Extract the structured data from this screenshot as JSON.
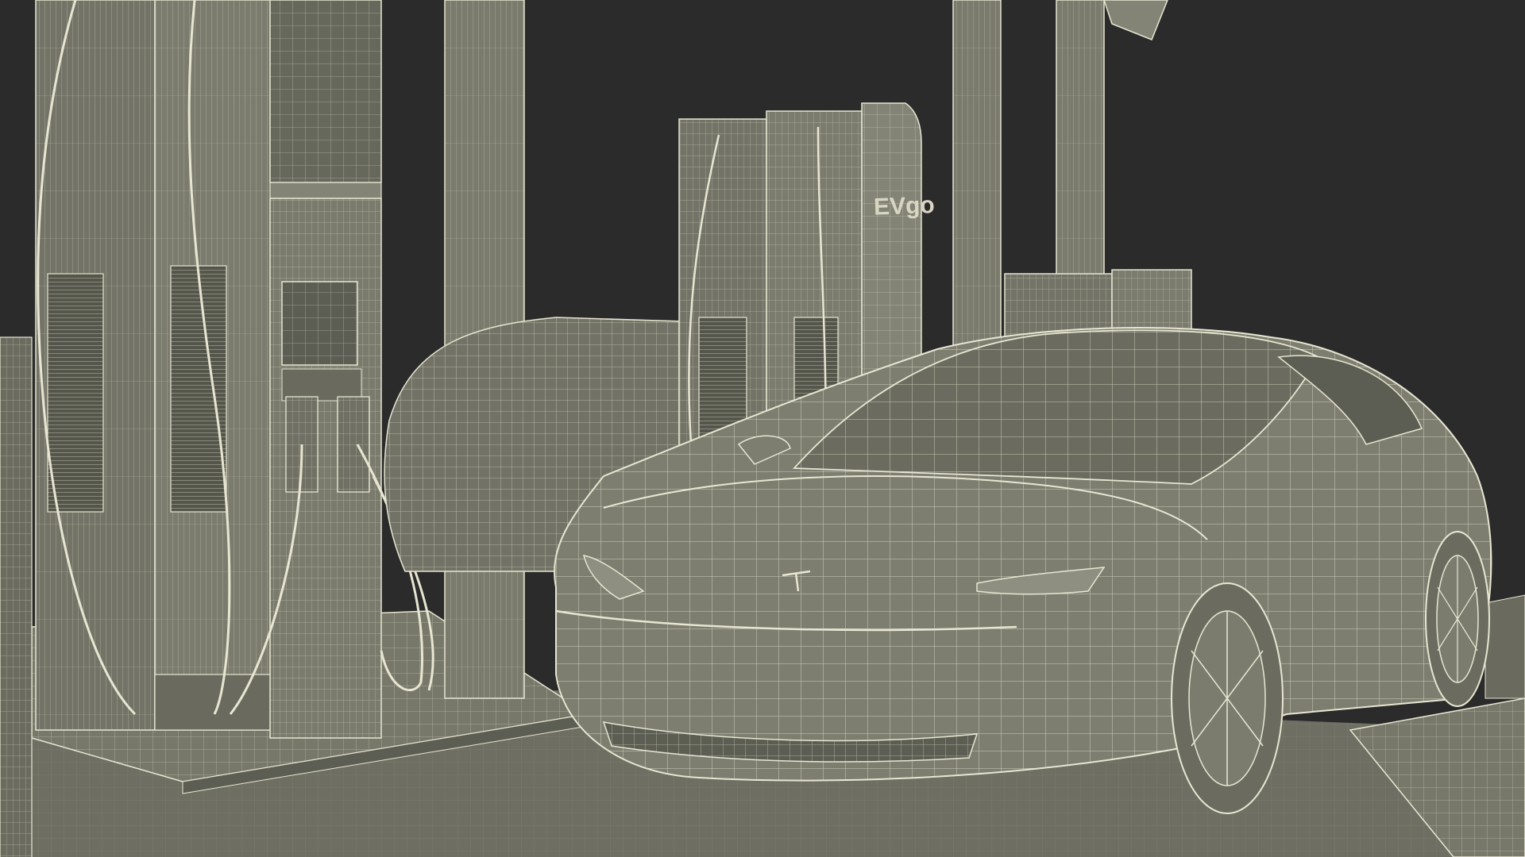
{
  "scene": {
    "background_color": "#2b2b2b",
    "floor_color": "#6e6e62",
    "wire_color": "#e8e6d2",
    "mesh_color": "#78796b",
    "mesh_dark_color": "#4f5046"
  },
  "ev_charger": {
    "brand_text": "EVgo"
  }
}
